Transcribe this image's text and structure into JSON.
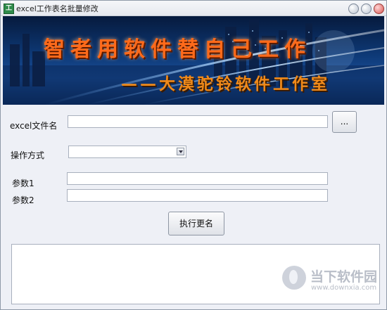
{
  "window": {
    "title": "excel工作表名批量修改",
    "icon_text": "工"
  },
  "banner": {
    "line1": "智者用软件替自己工作",
    "line2": "——大漠驼铃软件工作室"
  },
  "form": {
    "file_label": "excel文件名",
    "file_value": "",
    "browse_label": "...",
    "mode_label": "操作方式",
    "mode_value": "",
    "param1_label": "参数1",
    "param1_value": "",
    "param2_label": "参数2",
    "param2_value": "",
    "execute_label": "执行更名"
  },
  "output": {
    "text": ""
  },
  "watermark": {
    "name": "当下软件园",
    "url": "www.downxia.com"
  }
}
